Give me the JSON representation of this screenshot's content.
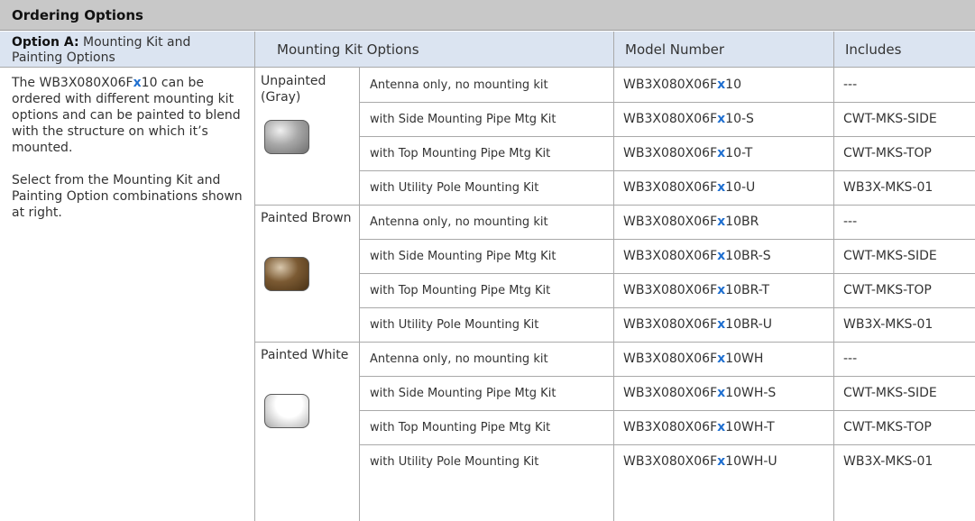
{
  "title": "Ordering Options",
  "header": {
    "option_label": "Option A:",
    "option_text": "Mounting Kit and Painting Options",
    "col_kit": "Mounting Kit Options",
    "col_model": "Model Number",
    "col_includes": "Includes"
  },
  "description": {
    "p1_pre": "The WB3X080X06F",
    "p1_x": "x",
    "p1_post": "10 can be ordered with different mounting kit options and can be painted to blend with the structure on which it’s mounted.",
    "p2": "Select from the Mounting Kit and Painting Option combinations shown at right."
  },
  "groups": [
    {
      "label": "Unpainted (Gray)",
      "swatch_color": "#9a9a9a",
      "rows": [
        {
          "kit": "Antenna only, no mounting kit",
          "model_pre": "WB3X080X06F",
          "model_x": "x",
          "model_post": "10",
          "includes": "---"
        },
        {
          "kit": "with Side Mounting Pipe Mtg Kit",
          "model_pre": "WB3X080X06F",
          "model_x": "x",
          "model_post": "10-S",
          "includes": "CWT-MKS-SIDE"
        },
        {
          "kit": "with Top Mounting Pipe Mtg Kit",
          "model_pre": "WB3X080X06F",
          "model_x": "x",
          "model_post": "10-T",
          "includes": "CWT-MKS-TOP"
        },
        {
          "kit": "with Utility Pole Mounting Kit",
          "model_pre": "WB3X080X06F",
          "model_x": "x",
          "model_post": "10-U",
          "includes": "WB3X-MKS-01"
        }
      ]
    },
    {
      "label": "Painted Brown",
      "swatch_color": "#6b4a24",
      "rows": [
        {
          "kit": "Antenna only, no mounting kit",
          "model_pre": "WB3X080X06F",
          "model_x": "x",
          "model_post": "10BR",
          "includes": "---"
        },
        {
          "kit": "with Side Mounting Pipe Mtg Kit",
          "model_pre": "WB3X080X06F",
          "model_x": "x",
          "model_post": "10BR-S",
          "includes": "CWT-MKS-SIDE"
        },
        {
          "kit": "with Top Mounting Pipe Mtg Kit",
          "model_pre": "WB3X080X06F",
          "model_x": "x",
          "model_post": "10BR-T",
          "includes": "CWT-MKS-TOP"
        },
        {
          "kit": "with Utility Pole Mounting Kit",
          "model_pre": "WB3X080X06F",
          "model_x": "x",
          "model_post": "10BR-U",
          "includes": "WB3X-MKS-01"
        }
      ]
    },
    {
      "label": "Painted White",
      "swatch_color": "#f2f2f2",
      "rows": [
        {
          "kit": "Antenna only, no mounting kit",
          "model_pre": "WB3X080X06F",
          "model_x": "x",
          "model_post": "10WH",
          "includes": "---"
        },
        {
          "kit": "with Side Mounting Pipe Mtg Kit",
          "model_pre": "WB3X080X06F",
          "model_x": "x",
          "model_post": "10WH-S",
          "includes": "CWT-MKS-SIDE"
        },
        {
          "kit": "with Top Mounting Pipe Mtg Kit",
          "model_pre": "WB3X080X06F",
          "model_x": "x",
          "model_post": "10WH-T",
          "includes": "CWT-MKS-TOP"
        },
        {
          "kit": "with Utility Pole Mounting Kit",
          "model_pre": "WB3X080X06F",
          "model_x": "x",
          "model_post": "10WH-U",
          "includes": "WB3X-MKS-01"
        }
      ]
    }
  ],
  "colors": {
    "title_bg": "#c8c8c8",
    "header_bg": "#dbe4f1",
    "highlight": "#1f6fd0",
    "grid": "#a9a9a9"
  }
}
